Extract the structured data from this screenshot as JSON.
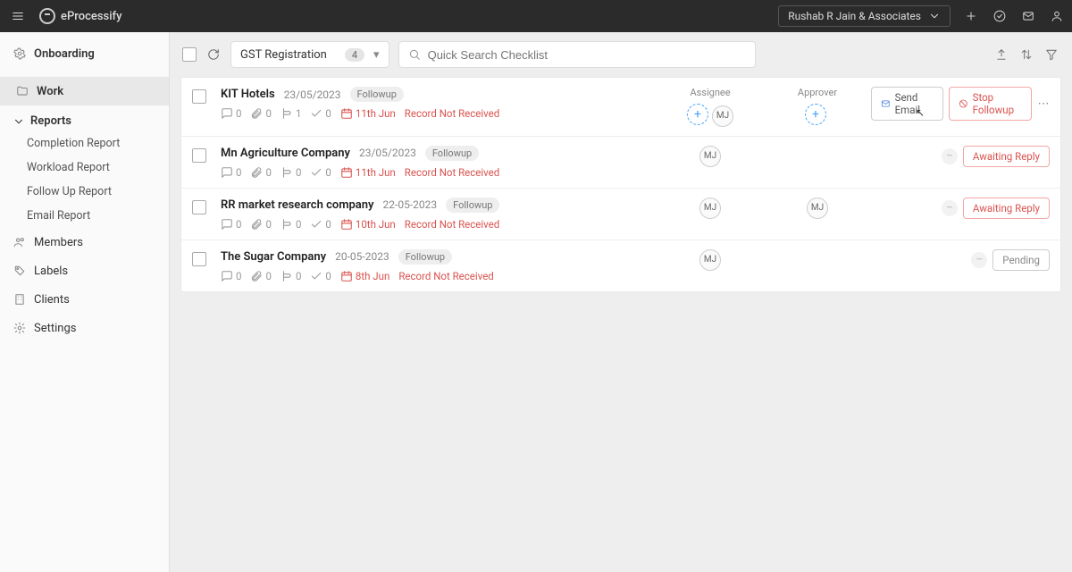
{
  "brand": "eProcessify",
  "org": "Rushab R Jain & Associates",
  "sidebar": {
    "onboarding": "Onboarding",
    "work": "Work",
    "reports_label": "Reports",
    "reports": [
      "Completion Report",
      "Workload Report",
      "Follow Up Report",
      "Email Report"
    ],
    "members": "Members",
    "labels": "Labels",
    "clients": "Clients",
    "settings": "Settings"
  },
  "toolbar": {
    "checklist": "GST Registration",
    "count": "4",
    "search_placeholder": "Quick Search Checklist"
  },
  "headers": {
    "assignee": "Assignee",
    "approver": "Approver"
  },
  "actions": {
    "send_email": "Send Email",
    "stop_followup": "Stop Followup",
    "awaiting": "Awaiting Reply",
    "pending": "Pending"
  },
  "rows": [
    {
      "title": "KIT Hotels",
      "date": "23/05/2023",
      "badge": "Followup",
      "comments": "0",
      "attachments": "0",
      "sub1": "1",
      "sub2": "0",
      "due": "11th Jun",
      "status": "Record Not Received",
      "assignee": [
        "MJ"
      ],
      "assignee_add": true,
      "approver": [],
      "approver_add": true,
      "action_mode": "hover"
    },
    {
      "title": "Mn Agriculture Company",
      "date": "23/05/2023",
      "badge": "Followup",
      "comments": "0",
      "attachments": "0",
      "sub1": "0",
      "sub2": "0",
      "due": "11th Jun",
      "status": "Record Not Received",
      "assignee": [
        "MJ"
      ],
      "assignee_add": false,
      "approver": [],
      "approver_add": false,
      "action_mode": "awaiting"
    },
    {
      "title": "RR market research company",
      "date": "22-05-2023",
      "badge": "Followup",
      "comments": "0",
      "attachments": "0",
      "sub1": "0",
      "sub2": "0",
      "due": "10th Jun",
      "status": "Record Not Received",
      "assignee": [
        "MJ"
      ],
      "assignee_add": false,
      "approver": [
        "MJ"
      ],
      "approver_add": false,
      "action_mode": "awaiting"
    },
    {
      "title": "The Sugar Company",
      "date": "20-05-2023",
      "badge": "Followup",
      "comments": "0",
      "attachments": "0",
      "sub1": "0",
      "sub2": "0",
      "due": "8th Jun",
      "status": "Record Not Received",
      "assignee": [
        "MJ"
      ],
      "assignee_add": false,
      "approver": [],
      "approver_add": false,
      "action_mode": "pending"
    }
  ]
}
